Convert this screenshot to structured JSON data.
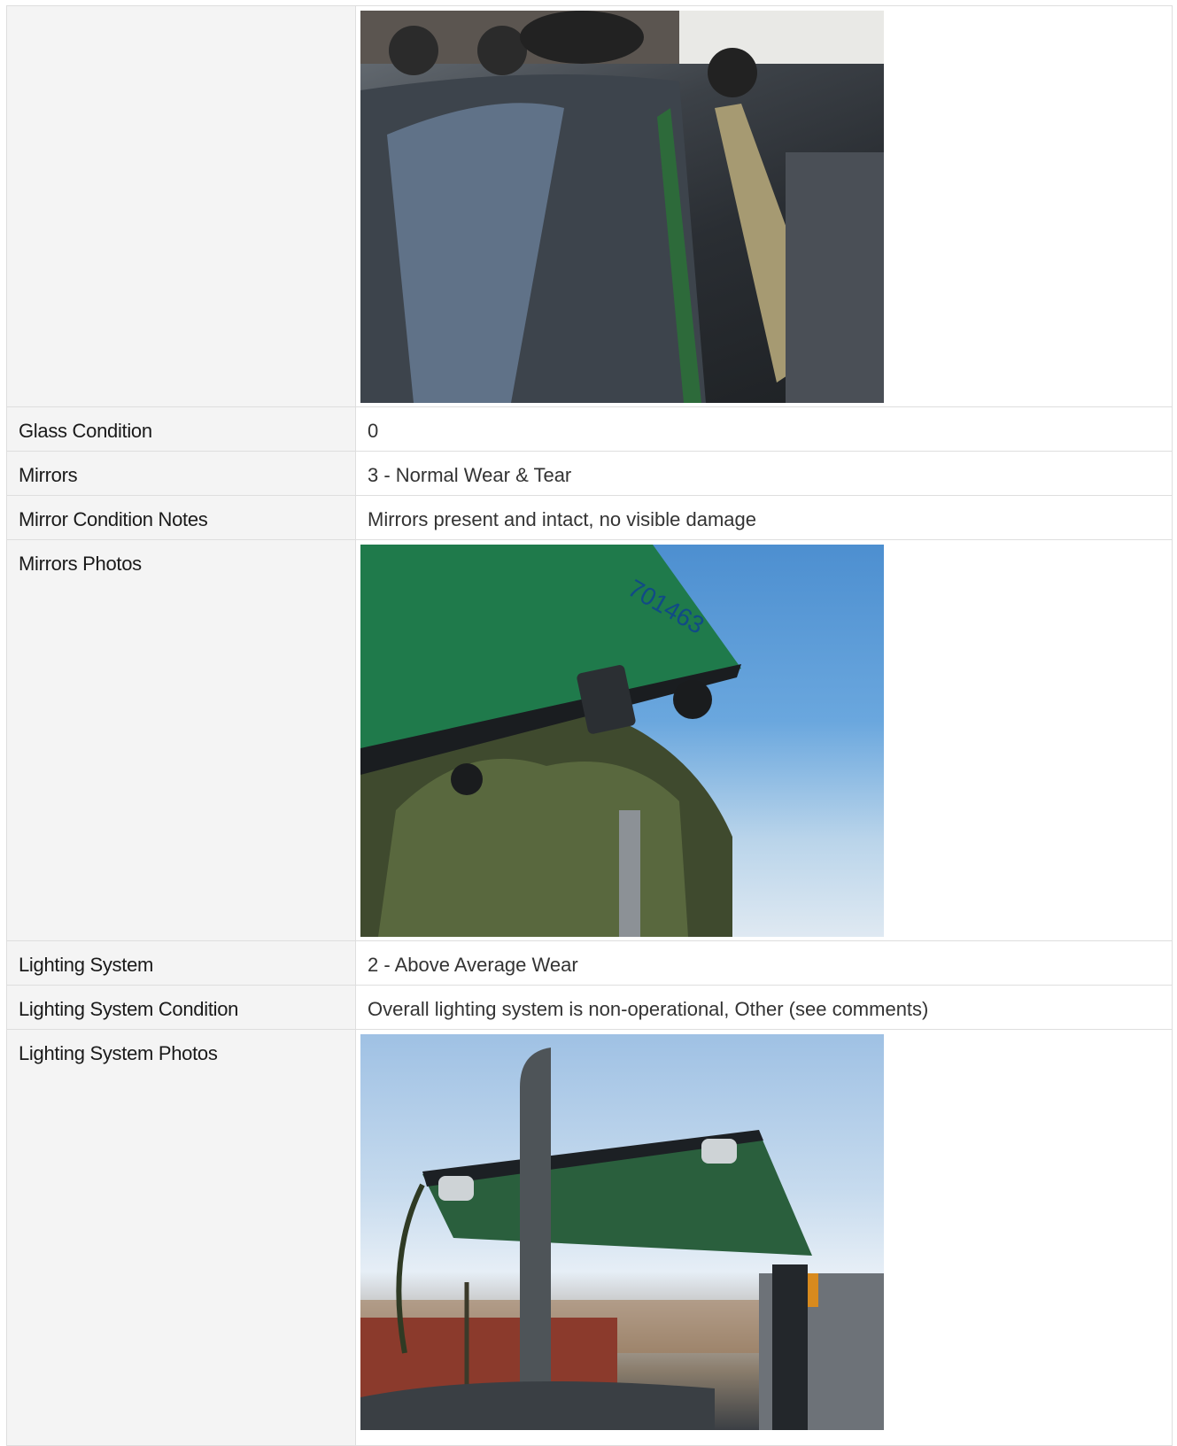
{
  "rows": [
    {
      "type": "photo",
      "label": "",
      "photo_name": "exterior-damage-photo"
    },
    {
      "type": "text",
      "label": "Glass Condition",
      "value": "0"
    },
    {
      "type": "text",
      "label": "Mirrors",
      "value": "3 - Normal Wear & Tear"
    },
    {
      "type": "text",
      "label": "Mirror Condition Notes",
      "value": "Mirrors present and intact, no visible damage"
    },
    {
      "type": "photo",
      "label": "Mirrors Photos",
      "photo_name": "mirrors-photo"
    },
    {
      "type": "text",
      "label": "Lighting System",
      "value": "2 - Above Average Wear"
    },
    {
      "type": "text",
      "label": "Lighting System Condition",
      "value": "Overall lighting system is non-operational, Other (see comments)"
    },
    {
      "type": "photo",
      "label": "Lighting System Photos",
      "photo_name": "lighting-system-photo"
    }
  ],
  "photo_texts": {
    "canopy_number": "701463"
  }
}
